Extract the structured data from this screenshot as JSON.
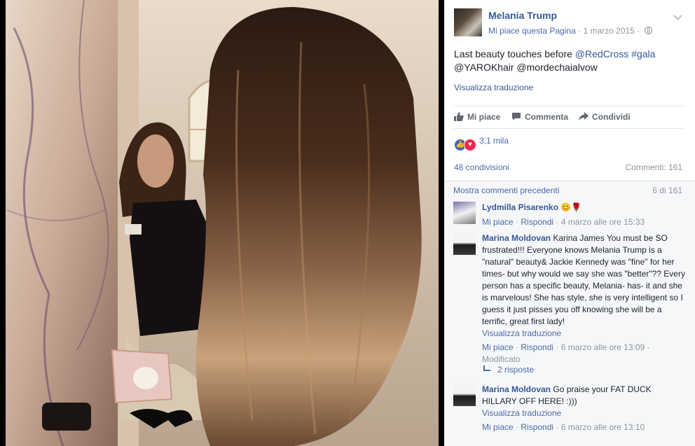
{
  "page": {
    "name": "Melania Trump",
    "like_page": "Mi piace questa Pagina",
    "separator": "·",
    "date": "1 marzo 2015",
    "separator2": "·"
  },
  "post": {
    "text_1": "Last beauty touches before ",
    "mention_1": "@RedCross",
    "text_2": " ",
    "hashtag": "#gala",
    "mention_2": "@YAROKhair",
    "text_3": " @mordechaialvow",
    "translate": "Visualizza traduzione"
  },
  "actions": {
    "like": "Mi piace",
    "comment": "Commenta",
    "share": "Condividi"
  },
  "stats": {
    "reactions": "3,1 mila",
    "shares": "48 condivisioni",
    "comments": "Commenti: 161"
  },
  "comments_header": {
    "previous": "Mostra commenti precedenti",
    "count": "6 di 161"
  },
  "comments": [
    {
      "author": "Lydmilla Pisarenko",
      "text": "",
      "like": "Mi piace",
      "reply": "Rispondi",
      "dot": "·",
      "time": "4 marzo alle ore 15:33"
    },
    {
      "author": "Marina Moldovan",
      "text": "Karina James You must be SO frustrated!!! Everyone knows Melania Trump is a \"natural\" beauty& Jackie Kennedy was \"fine\" for her times- but why would we say she was \"better\"?? Every person has a specific beauty, Melania- has- it and she is marvelous! She has style, she is very intelligent so I guess it just pisses you off knowing she will be a terrific, great first lady!",
      "translate": "Visualizza traduzione",
      "like": "Mi piace",
      "reply": "Rispondi",
      "dot": "·",
      "time": "6 marzo alle ore 13:09",
      "edited": "Modificato",
      "replies": "2 risposte"
    },
    {
      "author": "Marina Moldovan",
      "text": "Go praise your FAT DUCK HILLARY OFF HERE! :)))",
      "translate": "Visualizza traduzione",
      "like": "Mi piace",
      "reply": "Rispondi",
      "dot": "·",
      "time": "6 marzo alle ore 13:10"
    }
  ],
  "colors": {
    "link": "#365899",
    "meta": "#90949c",
    "like_blue": "#4267b2",
    "love_red": "#f0284a"
  }
}
